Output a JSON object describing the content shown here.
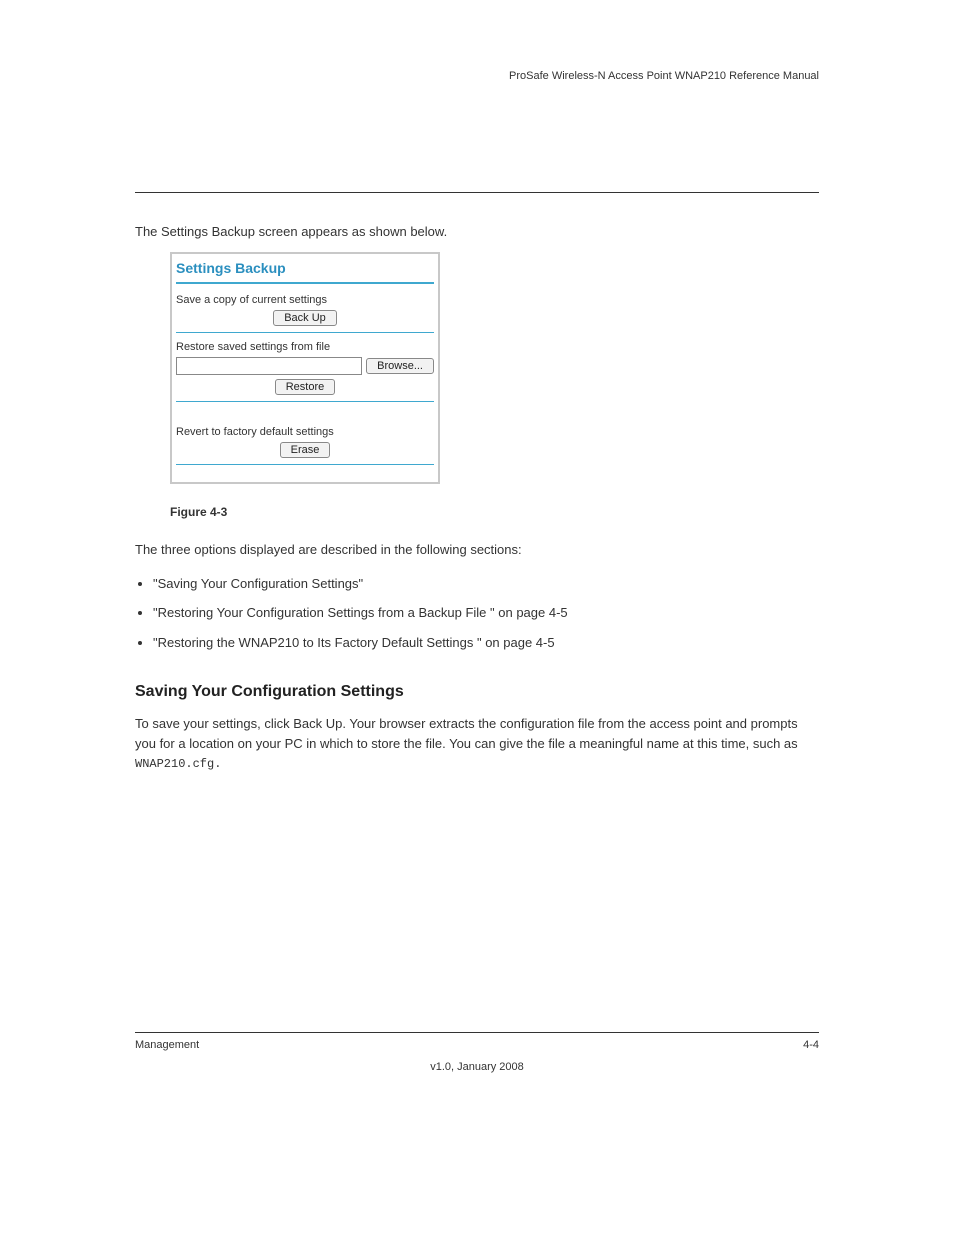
{
  "header": {
    "product": "ProSafe Wireless-N Access Point WNAP210 Reference Manual"
  },
  "intro": "The Settings Backup screen appears as shown below.",
  "panel": {
    "title": "Settings Backup",
    "save_label": "Save a copy of current settings",
    "backup_btn": "Back Up",
    "restore_label": "Restore saved settings from file",
    "browse_btn": "Browse...",
    "restore_btn": "Restore",
    "revert_label": "Revert to factory default settings",
    "erase_btn": "Erase"
  },
  "caption": "Figure 4-3",
  "body": {
    "p1": "The three options displayed are described in the following sections:",
    "bullets": [
      "\"Saving Your Configuration Settings\"",
      "\"Restoring Your Configuration Settings from a Backup File \" on page 4-5",
      "\"Restoring the WNAP210 to Its Factory Default Settings \" on page 4-5"
    ],
    "h3": "Saving Your Configuration Settings",
    "p2": "To save your settings, click Back Up. Your browser extracts the configuration file from the access point and prompts you for a location on your PC in which to store the file. You can give the file a meaningful name at this time, such as ",
    "filename": "WNAP210.cfg."
  },
  "footer": {
    "left": "Management",
    "right": "4-4",
    "version": "v1.0, January 2008"
  }
}
